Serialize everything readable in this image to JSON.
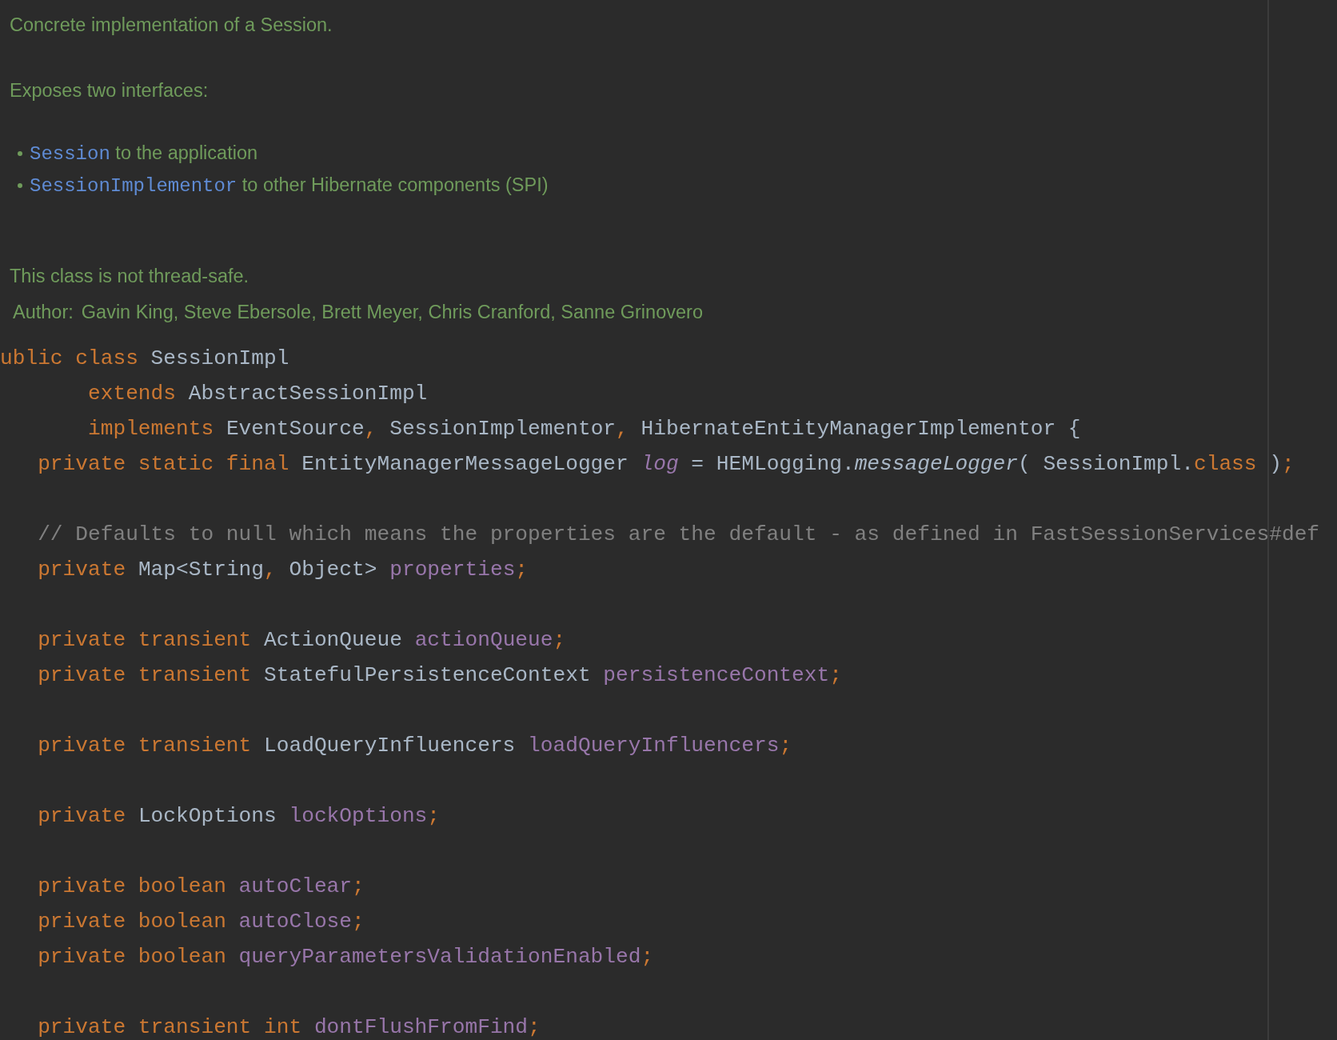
{
  "doc": {
    "summary": "Concrete implementation of a Session.",
    "intro": "Exposes two interfaces:",
    "bullets": [
      {
        "link": "Session",
        "text": "to the application"
      },
      {
        "link": "SessionImplementor",
        "text": "to other Hibernate components (SPI)"
      }
    ],
    "note": "This class is not thread-safe.",
    "author": {
      "label": "Author:",
      "value": "Gavin King, Steve Ebersole, Brett Meyer, Chris Cranford, Sanne Grinovero"
    }
  },
  "code": {
    "blocks": [
      [
        [
          {
            "kind": "keyword",
            "text": "ublic class "
          },
          {
            "kind": "plain",
            "text": "SessionImpl"
          }
        ],
        [
          {
            "kind": "keyword",
            "text": "       extends "
          },
          {
            "kind": "plain",
            "text": "AbstractSessionImpl"
          }
        ],
        [
          {
            "kind": "keyword",
            "text": "       implements "
          },
          {
            "kind": "plain",
            "text": "EventSource"
          },
          {
            "kind": "keyword",
            "text": ", "
          },
          {
            "kind": "plain",
            "text": "SessionImplementor"
          },
          {
            "kind": "keyword",
            "text": ", "
          },
          {
            "kind": "plain",
            "text": "HibernateEntityManagerImplementor {"
          }
        ],
        [
          {
            "kind": "keyword",
            "text": "   private static final "
          },
          {
            "kind": "plain",
            "text": "EntityManagerMessageLogger "
          },
          {
            "kind": "static_field",
            "text": "log"
          },
          {
            "kind": "plain",
            "text": " = HEMLogging."
          },
          {
            "kind": "static_method",
            "text": "messageLogger"
          },
          {
            "kind": "plain",
            "text": "( SessionImpl."
          },
          {
            "kind": "keyword",
            "text": "class"
          },
          {
            "kind": "plain",
            "text": " )"
          },
          {
            "kind": "keyword",
            "text": ";"
          }
        ]
      ],
      [
        [
          {
            "kind": "comment",
            "text": "   // Defaults to null which means the properties are the default - as defined in FastSessionServices#def"
          }
        ],
        [
          {
            "kind": "keyword",
            "text": "   private "
          },
          {
            "kind": "plain",
            "text": "Map<String"
          },
          {
            "kind": "keyword",
            "text": ", "
          },
          {
            "kind": "plain",
            "text": "Object> "
          },
          {
            "kind": "field",
            "text": "properties"
          },
          {
            "kind": "keyword",
            "text": ";"
          }
        ]
      ],
      [
        [
          {
            "kind": "keyword",
            "text": "   private transient "
          },
          {
            "kind": "plain",
            "text": "ActionQueue "
          },
          {
            "kind": "field",
            "text": "actionQueue"
          },
          {
            "kind": "keyword",
            "text": ";"
          }
        ],
        [
          {
            "kind": "keyword",
            "text": "   private transient "
          },
          {
            "kind": "plain",
            "text": "StatefulPersistenceContext "
          },
          {
            "kind": "field",
            "text": "persistenceContext"
          },
          {
            "kind": "keyword",
            "text": ";"
          }
        ]
      ],
      [
        [
          {
            "kind": "keyword",
            "text": "   private transient "
          },
          {
            "kind": "plain",
            "text": "LoadQueryInfluencers "
          },
          {
            "kind": "field",
            "text": "loadQueryInfluencers"
          },
          {
            "kind": "keyword",
            "text": ";"
          }
        ]
      ],
      [
        [
          {
            "kind": "keyword",
            "text": "   private "
          },
          {
            "kind": "plain",
            "text": "LockOptions "
          },
          {
            "kind": "field",
            "text": "lockOptions"
          },
          {
            "kind": "keyword",
            "text": ";"
          }
        ]
      ],
      [
        [
          {
            "kind": "keyword",
            "text": "   private boolean "
          },
          {
            "kind": "field",
            "text": "autoClear"
          },
          {
            "kind": "keyword",
            "text": ";"
          }
        ],
        [
          {
            "kind": "keyword",
            "text": "   private boolean "
          },
          {
            "kind": "field",
            "text": "autoClose"
          },
          {
            "kind": "keyword",
            "text": ";"
          }
        ],
        [
          {
            "kind": "keyword",
            "text": "   private boolean "
          },
          {
            "kind": "field",
            "text": "queryParametersValidationEnabled"
          },
          {
            "kind": "keyword",
            "text": ";"
          }
        ]
      ],
      [
        [
          {
            "kind": "keyword",
            "text": "   private transient int "
          },
          {
            "kind": "field",
            "text": "dontFlushFromFind"
          },
          {
            "kind": "keyword",
            "text": ";"
          }
        ]
      ]
    ]
  }
}
